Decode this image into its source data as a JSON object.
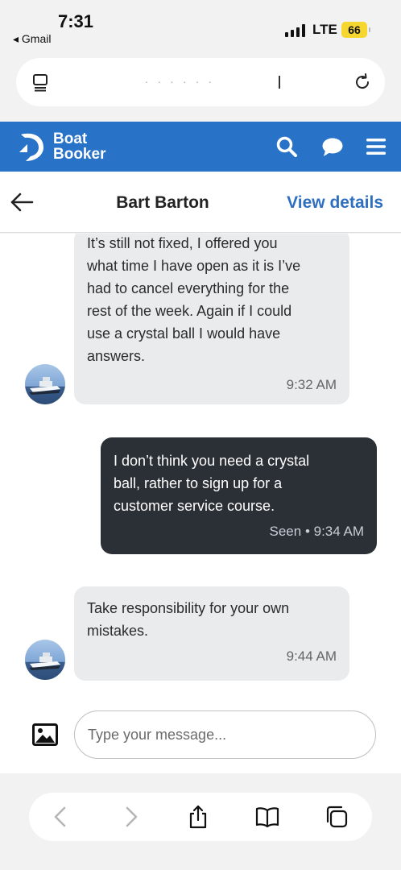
{
  "status_bar": {
    "time": "7:31",
    "back_app": "◂ Gmail",
    "network": "LTE",
    "battery": "66"
  },
  "browser": {
    "url_text": ". . .  . . ."
  },
  "app": {
    "brand_line1": "Boat",
    "brand_line2": "Booker",
    "brand_color": "#2872c8"
  },
  "chat": {
    "contact_name": "Bart Barton",
    "view_details_label": "View details",
    "messages": [
      {
        "direction": "incoming",
        "lines": [
          "It’s still not fixed, I offered you",
          "what time I have open as it is I’ve",
          "had to cancel everything for the",
          "rest of the week.  Again if I could",
          "use a crystal ball I would have",
          "answers."
        ],
        "time": "9:32 AM"
      },
      {
        "direction": "outgoing",
        "lines": [
          "I don’t think you need a crystal",
          "ball, rather to sign up for a",
          "customer service course."
        ],
        "time": "Seen • 9:34 AM"
      },
      {
        "direction": "incoming",
        "lines": [
          "Take responsibility for your own",
          "mistakes."
        ],
        "time": "9:44 AM"
      }
    ]
  },
  "composer": {
    "placeholder": "Type your message..."
  }
}
